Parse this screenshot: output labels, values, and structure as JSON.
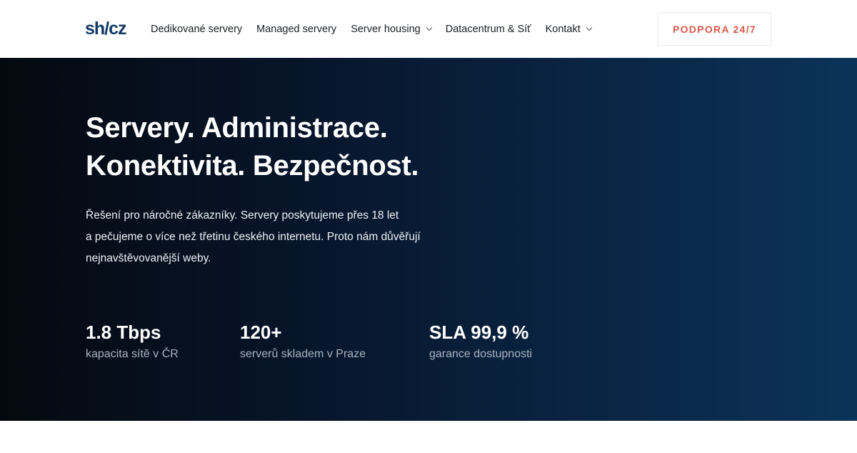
{
  "header": {
    "logo_text": "sh/cz",
    "nav": [
      {
        "label": "Dedikované servery",
        "has_dropdown": false
      },
      {
        "label": "Managed servery",
        "has_dropdown": false
      },
      {
        "label": "Server housing",
        "has_dropdown": true
      },
      {
        "label": "Datacentrum & Síť",
        "has_dropdown": false
      },
      {
        "label": "Kontakt",
        "has_dropdown": true
      }
    ],
    "support_button": "PODPORA 24/7"
  },
  "hero": {
    "title_line1": "Servery. Administrace.",
    "title_line2": "Konektivita. Bezpečnost.",
    "description_line1": "Řešení pro náročné zákazníky. Servery poskytujeme přes 18 let",
    "description_line2": "a pečujeme o více než třetinu českého internetu. Proto nám důvěřují",
    "description_line3": "nejnavštěvovanější weby.",
    "stats": [
      {
        "value": "1.8 Tbps",
        "label": "kapacita sítě v ČR"
      },
      {
        "value": "120+",
        "label": "serverů skladem v Praze"
      },
      {
        "value": "SLA 99,9 %",
        "label": "garance dostupnosti"
      }
    ]
  },
  "colors": {
    "brand": "#123a67",
    "accent": "#d9574a",
    "hero_gradient_start": "#04090f",
    "hero_gradient_end": "#0b3359"
  }
}
